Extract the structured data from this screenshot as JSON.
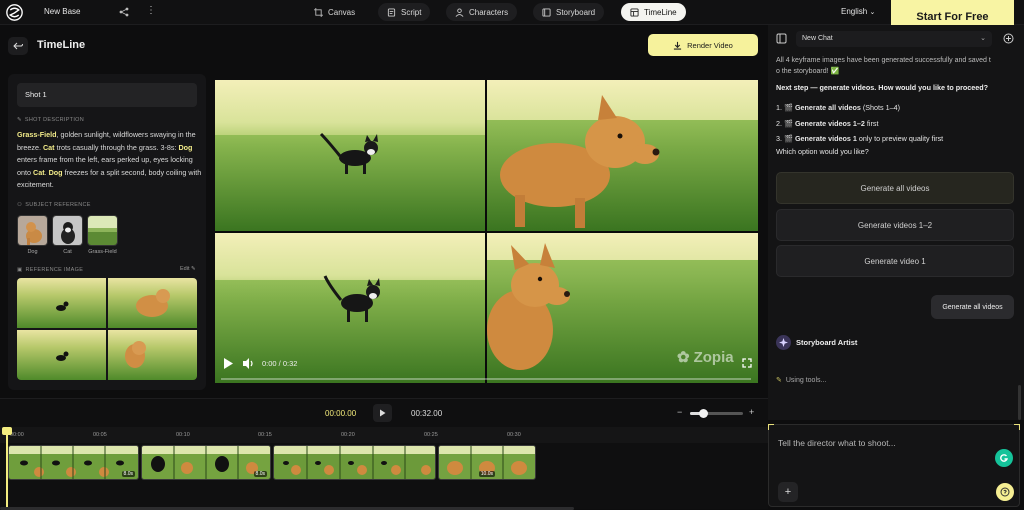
{
  "topbar": {
    "base_name": "New Base",
    "tabs": [
      {
        "label": "Canvas",
        "icon": "crop-icon"
      },
      {
        "label": "Script",
        "icon": "script-icon"
      },
      {
        "label": "Characters",
        "icon": "person-icon"
      },
      {
        "label": "Storyboard",
        "icon": "storyboard-icon"
      },
      {
        "label": "TimeLine",
        "icon": "timeline-icon"
      }
    ],
    "active_tab": "TimeLine",
    "language": "English",
    "cta": "Start For Free"
  },
  "header": {
    "title": "TimeLine",
    "render_label": "Render Video"
  },
  "shot_panel": {
    "shot_label": "Shot 1",
    "description_heading": "SHOT DESCRIPTION",
    "desc": {
      "p1": "Grass-Field",
      "p2": ", golden sunlight, wildflowers swaying in the breeze. ",
      "p3": "Cat",
      "p4": " trots casually through the grass. 3-8s: ",
      "p5": "Dog",
      "p6": " enters frame from the left, ears perked up, eyes locking onto ",
      "p7": "Cat",
      "p8": ". ",
      "p9": "Dog",
      "p10": " freezes for a split second, body coiling with excitement."
    },
    "subject_heading": "SUBJECT REFERENCE",
    "subjects": [
      "Dog",
      "Cat",
      "Grass-Field"
    ],
    "reference_heading": "REFERENCE IMAGE",
    "edit_label": "Edit"
  },
  "video": {
    "time_display": "0:00 / 0:32",
    "watermark": "Zopia"
  },
  "chat": {
    "session": "New Chat",
    "prev_line1": "All 4 keyframe images have been generated successfully and saved t",
    "prev_line2": "o the storyboard! ✅",
    "next_step": "Next step — generate videos. How would you like to proceed?",
    "options": [
      {
        "num": "1.",
        "bold": "Generate all videos",
        "rest": " (Shots 1–4)"
      },
      {
        "num": "2.",
        "bold": "Generate videos 1–2",
        "rest": " first"
      },
      {
        "num": "3.",
        "bold": "Generate videos 1",
        "rest": " only to preview quality first"
      }
    ],
    "question": "Which option would you like?",
    "buttons": [
      "Generate all videos",
      "Generate videos 1–2",
      "Generate video 1"
    ],
    "user_message": "Generate all videos",
    "agent_name": "Storyboard Artist",
    "status": "Using tools..."
  },
  "input": {
    "placeholder": "Tell the director what to shoot..."
  },
  "timeline": {
    "current": "00:00.00",
    "total": "00:32.00",
    "zoom_level": 0.25,
    "ticks": [
      "00:00",
      "00:05",
      "00:10",
      "00:15",
      "00:20",
      "00:25",
      "00:30"
    ],
    "clip_durations": [
      "8.0s",
      "8.0s",
      "",
      "10.0s"
    ]
  },
  "colors": {
    "accent": "#f6f29c",
    "highlight_text": "#f3ec8a",
    "background": "#0d0d0e"
  }
}
